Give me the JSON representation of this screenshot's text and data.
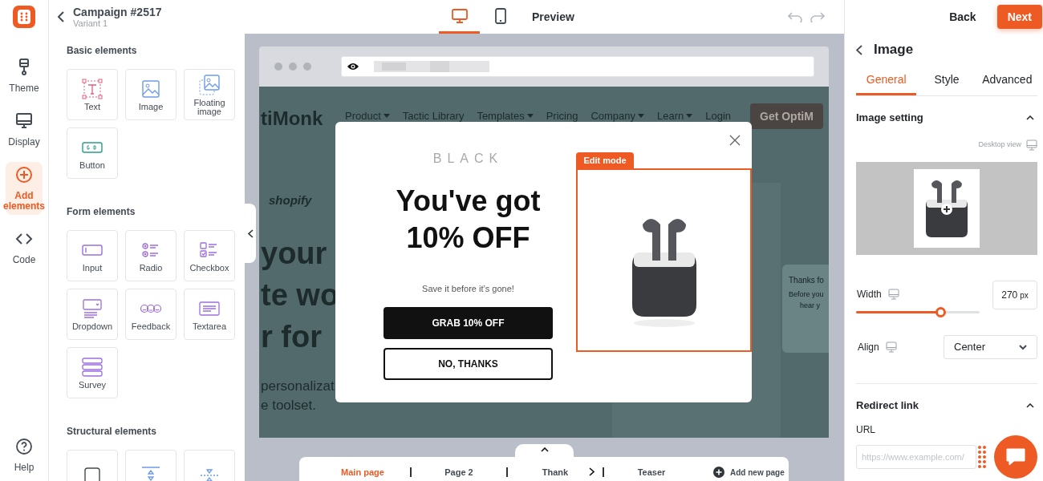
{
  "header": {
    "title": "Campaign #2517",
    "subtitle": "Variant 1"
  },
  "rail": [
    {
      "kind": "theme",
      "label": "Theme",
      "selected": false
    },
    {
      "kind": "display",
      "label": "Display",
      "selected": false
    },
    {
      "kind": "add",
      "label": "Add elements",
      "selected": true
    },
    {
      "kind": "code",
      "label": "Code",
      "selected": false
    }
  ],
  "help": {
    "label": "Help"
  },
  "element_groups": [
    {
      "title": "Basic elements",
      "items": [
        {
          "kind": "text",
          "label": "Text"
        },
        {
          "kind": "image",
          "label": "Image"
        },
        {
          "kind": "floating",
          "label": "Floating image"
        },
        {
          "kind": "button",
          "label": "Button"
        }
      ]
    },
    {
      "title": "Form elements",
      "items": [
        {
          "kind": "input",
          "label": "Input"
        },
        {
          "kind": "radio",
          "label": "Radio"
        },
        {
          "kind": "checkbox",
          "label": "Checkbox"
        },
        {
          "kind": "dropdown",
          "label": "Dropdown"
        },
        {
          "kind": "feedback",
          "label": "Feedback"
        },
        {
          "kind": "textarea",
          "label": "Textarea"
        },
        {
          "kind": "survey",
          "label": "Survey"
        }
      ]
    },
    {
      "title": "Structural elements",
      "items": [
        {
          "kind": "block"
        },
        {
          "kind": "spacer"
        },
        {
          "kind": "divider"
        }
      ]
    }
  ],
  "view_toggle": [
    {
      "kind": "desktop",
      "selected": true
    },
    {
      "kind": "mobile",
      "selected": false
    }
  ],
  "preview": "Preview",
  "actions": {
    "back": "Back",
    "next": "Next"
  },
  "website": {
    "logo": "tiMonk",
    "nav": [
      {
        "label": "Product",
        "dropdown": true
      },
      {
        "label": "Tactic Library",
        "dropdown": false
      },
      {
        "label": "Templates",
        "dropdown": true
      },
      {
        "label": "Pricing",
        "dropdown": false
      },
      {
        "label": "Company",
        "dropdown": true
      },
      {
        "label": "Learn",
        "dropdown": true
      },
      {
        "label": "Login",
        "dropdown": false
      }
    ],
    "cta": "Get OptiM",
    "partner": "shopify",
    "hero": [
      "your",
      "te wo",
      "r for"
    ],
    "subtext": [
      "personalizat",
      "e toolset."
    ],
    "card": [
      "Thanks fo",
      "Before you",
      "hear y"
    ]
  },
  "popup": {
    "brand": "BLACK",
    "headline": [
      "You've got",
      "10% OFF"
    ],
    "subtitle": "Save it before it’s gone!",
    "primary": "GRAB 10% OFF",
    "secondary": "NO, THANKS",
    "edit_badge": "Edit mode"
  },
  "pages": [
    {
      "label": "Main page",
      "selected": true
    },
    {
      "label": "Page 2",
      "selected": false
    },
    {
      "label": "Thank",
      "selected": false
    },
    {
      "label": "Teaser",
      "selected": false
    }
  ],
  "add_page": "Add new page",
  "inspector": {
    "title": "Image",
    "tabs": [
      {
        "label": "General",
        "selected": true
      },
      {
        "label": "Style",
        "selected": false
      },
      {
        "label": "Advanced",
        "selected": false
      }
    ],
    "sections": [
      {
        "title": "Image setting",
        "expanded": true
      },
      {
        "title": "Redirect link",
        "expanded": true
      }
    ],
    "view_note": "Desktop view",
    "width_label": "Width",
    "width": {
      "level": 0.68,
      "value": "270",
      "unit": "px"
    },
    "align_label": "Align",
    "align_value": "Center",
    "url_label": "URL",
    "url_placeholder": "https://www.example.com/"
  }
}
